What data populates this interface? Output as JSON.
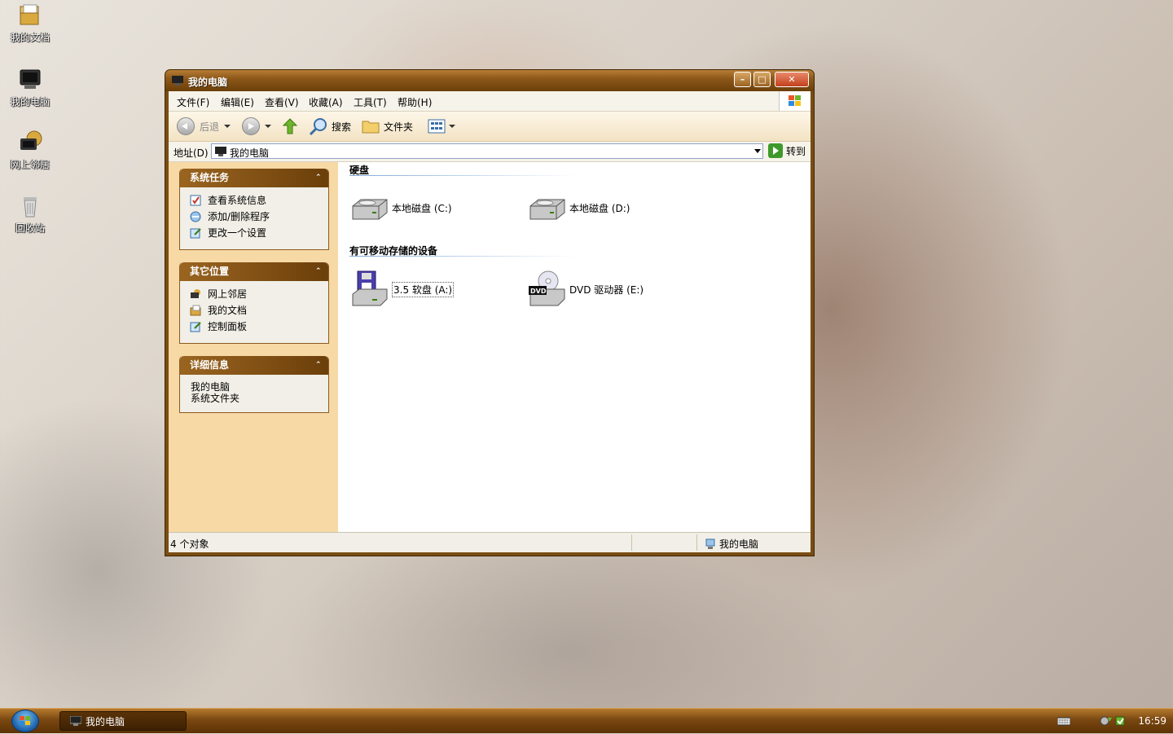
{
  "desktop": {
    "icons": [
      {
        "label": "我的文档",
        "icon": "my-documents-icon"
      },
      {
        "label": "我的电脑",
        "icon": "my-computer-icon"
      },
      {
        "label": "网上邻居",
        "icon": "network-places-icon"
      },
      {
        "label": "回收站",
        "icon": "recycle-bin-icon"
      }
    ]
  },
  "window": {
    "title": "我的电脑",
    "menu": [
      "文件(F)",
      "编辑(E)",
      "查看(V)",
      "收藏(A)",
      "工具(T)",
      "帮助(H)"
    ],
    "toolbar": {
      "back_label": "后退",
      "search_label": "搜索",
      "folders_label": "文件夹"
    },
    "address": {
      "label": "地址(D)",
      "value": "我的电脑",
      "go_label": "转到"
    },
    "tasks": {
      "system_tasks": {
        "title": "系统任务",
        "items": [
          "查看系统信息",
          "添加/删除程序",
          "更改一个设置"
        ]
      },
      "other_places": {
        "title": "其它位置",
        "items": [
          "网上邻居",
          "我的文档",
          "控制面板"
        ]
      },
      "details": {
        "title": "详细信息",
        "name": "我的电脑",
        "type": "系统文件夹"
      }
    },
    "groups": {
      "hard_disks": {
        "title": "硬盘",
        "drives": [
          "本地磁盘 (C:)",
          "本地磁盘 (D:)"
        ]
      },
      "removable": {
        "title": "有可移动存储的设备",
        "drives": [
          "3.5 软盘 (A:)",
          "DVD 驱动器 (E:)"
        ]
      }
    },
    "status": {
      "count": "4 个对象",
      "location": "我的电脑"
    }
  },
  "taskbar": {
    "task_label": "我的电脑",
    "clock": "16:59"
  },
  "colors": {
    "accent": "#7a4d12",
    "pane": "#f7d9a6"
  }
}
